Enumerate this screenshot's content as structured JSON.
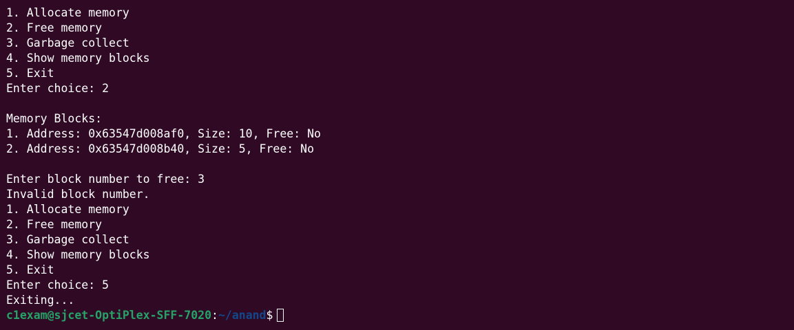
{
  "terminal": {
    "lines": [
      "1. Allocate memory",
      "2. Free memory",
      "3. Garbage collect",
      "4. Show memory blocks",
      "5. Exit",
      "Enter choice: 2",
      "",
      "Memory Blocks:",
      "1. Address: 0x63547d008af0, Size: 10, Free: No",
      "2. Address: 0x63547d008b40, Size: 5, Free: No",
      "",
      "Enter block number to free: 3",
      "Invalid block number.",
      "1. Allocate memory",
      "2. Free memory",
      "3. Garbage collect",
      "4. Show memory blocks",
      "5. Exit",
      "Enter choice: 5",
      "Exiting..."
    ],
    "prompt": {
      "user_host": "c1exam@sjcet-OptiPlex-SFF-7020",
      "separator": ":",
      "path": "~/anand",
      "symbol": "$"
    },
    "colors": {
      "background": "#300a24",
      "text": "#ffffff",
      "user_host": "#26a269",
      "path": "#12488b"
    }
  }
}
